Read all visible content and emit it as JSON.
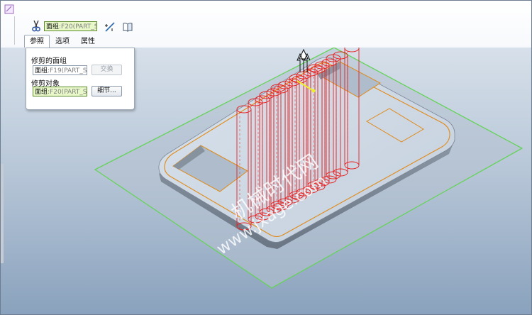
{
  "toolbar": {
    "trim_surface_field": {
      "main": "面组",
      "sub": ":F20(PART_S"
    },
    "icons": [
      "trim-scissors-icon",
      "flip-direction-icon",
      "open-book-icon"
    ]
  },
  "tabs": [
    {
      "label": "参照",
      "selected": true
    },
    {
      "label": "选项",
      "selected": false
    },
    {
      "label": "属性",
      "selected": false
    }
  ],
  "panel": {
    "trimmed_quilt_label": "修剪的面组",
    "trimmed_quilt_field": {
      "main": "面组",
      "sub": ":F19(PART_S"
    },
    "swap_button": "交换",
    "trim_object_label": "修剪对象",
    "trim_object_field": {
      "main": "面组",
      "sub": ":F20(PART_S"
    },
    "details_button": "细节..."
  },
  "watermark": {
    "cn": "机械时代网",
    "url": "www.jxage.com"
  },
  "colors": {
    "viewport_top": "#d7e0ea",
    "viewport_bottom": "#8aa2bd",
    "part_edge": "#e08a1a",
    "cylinders": "#e82020",
    "plane_edge": "#66d35a",
    "highlight_arrow": "#f0ee2a"
  }
}
